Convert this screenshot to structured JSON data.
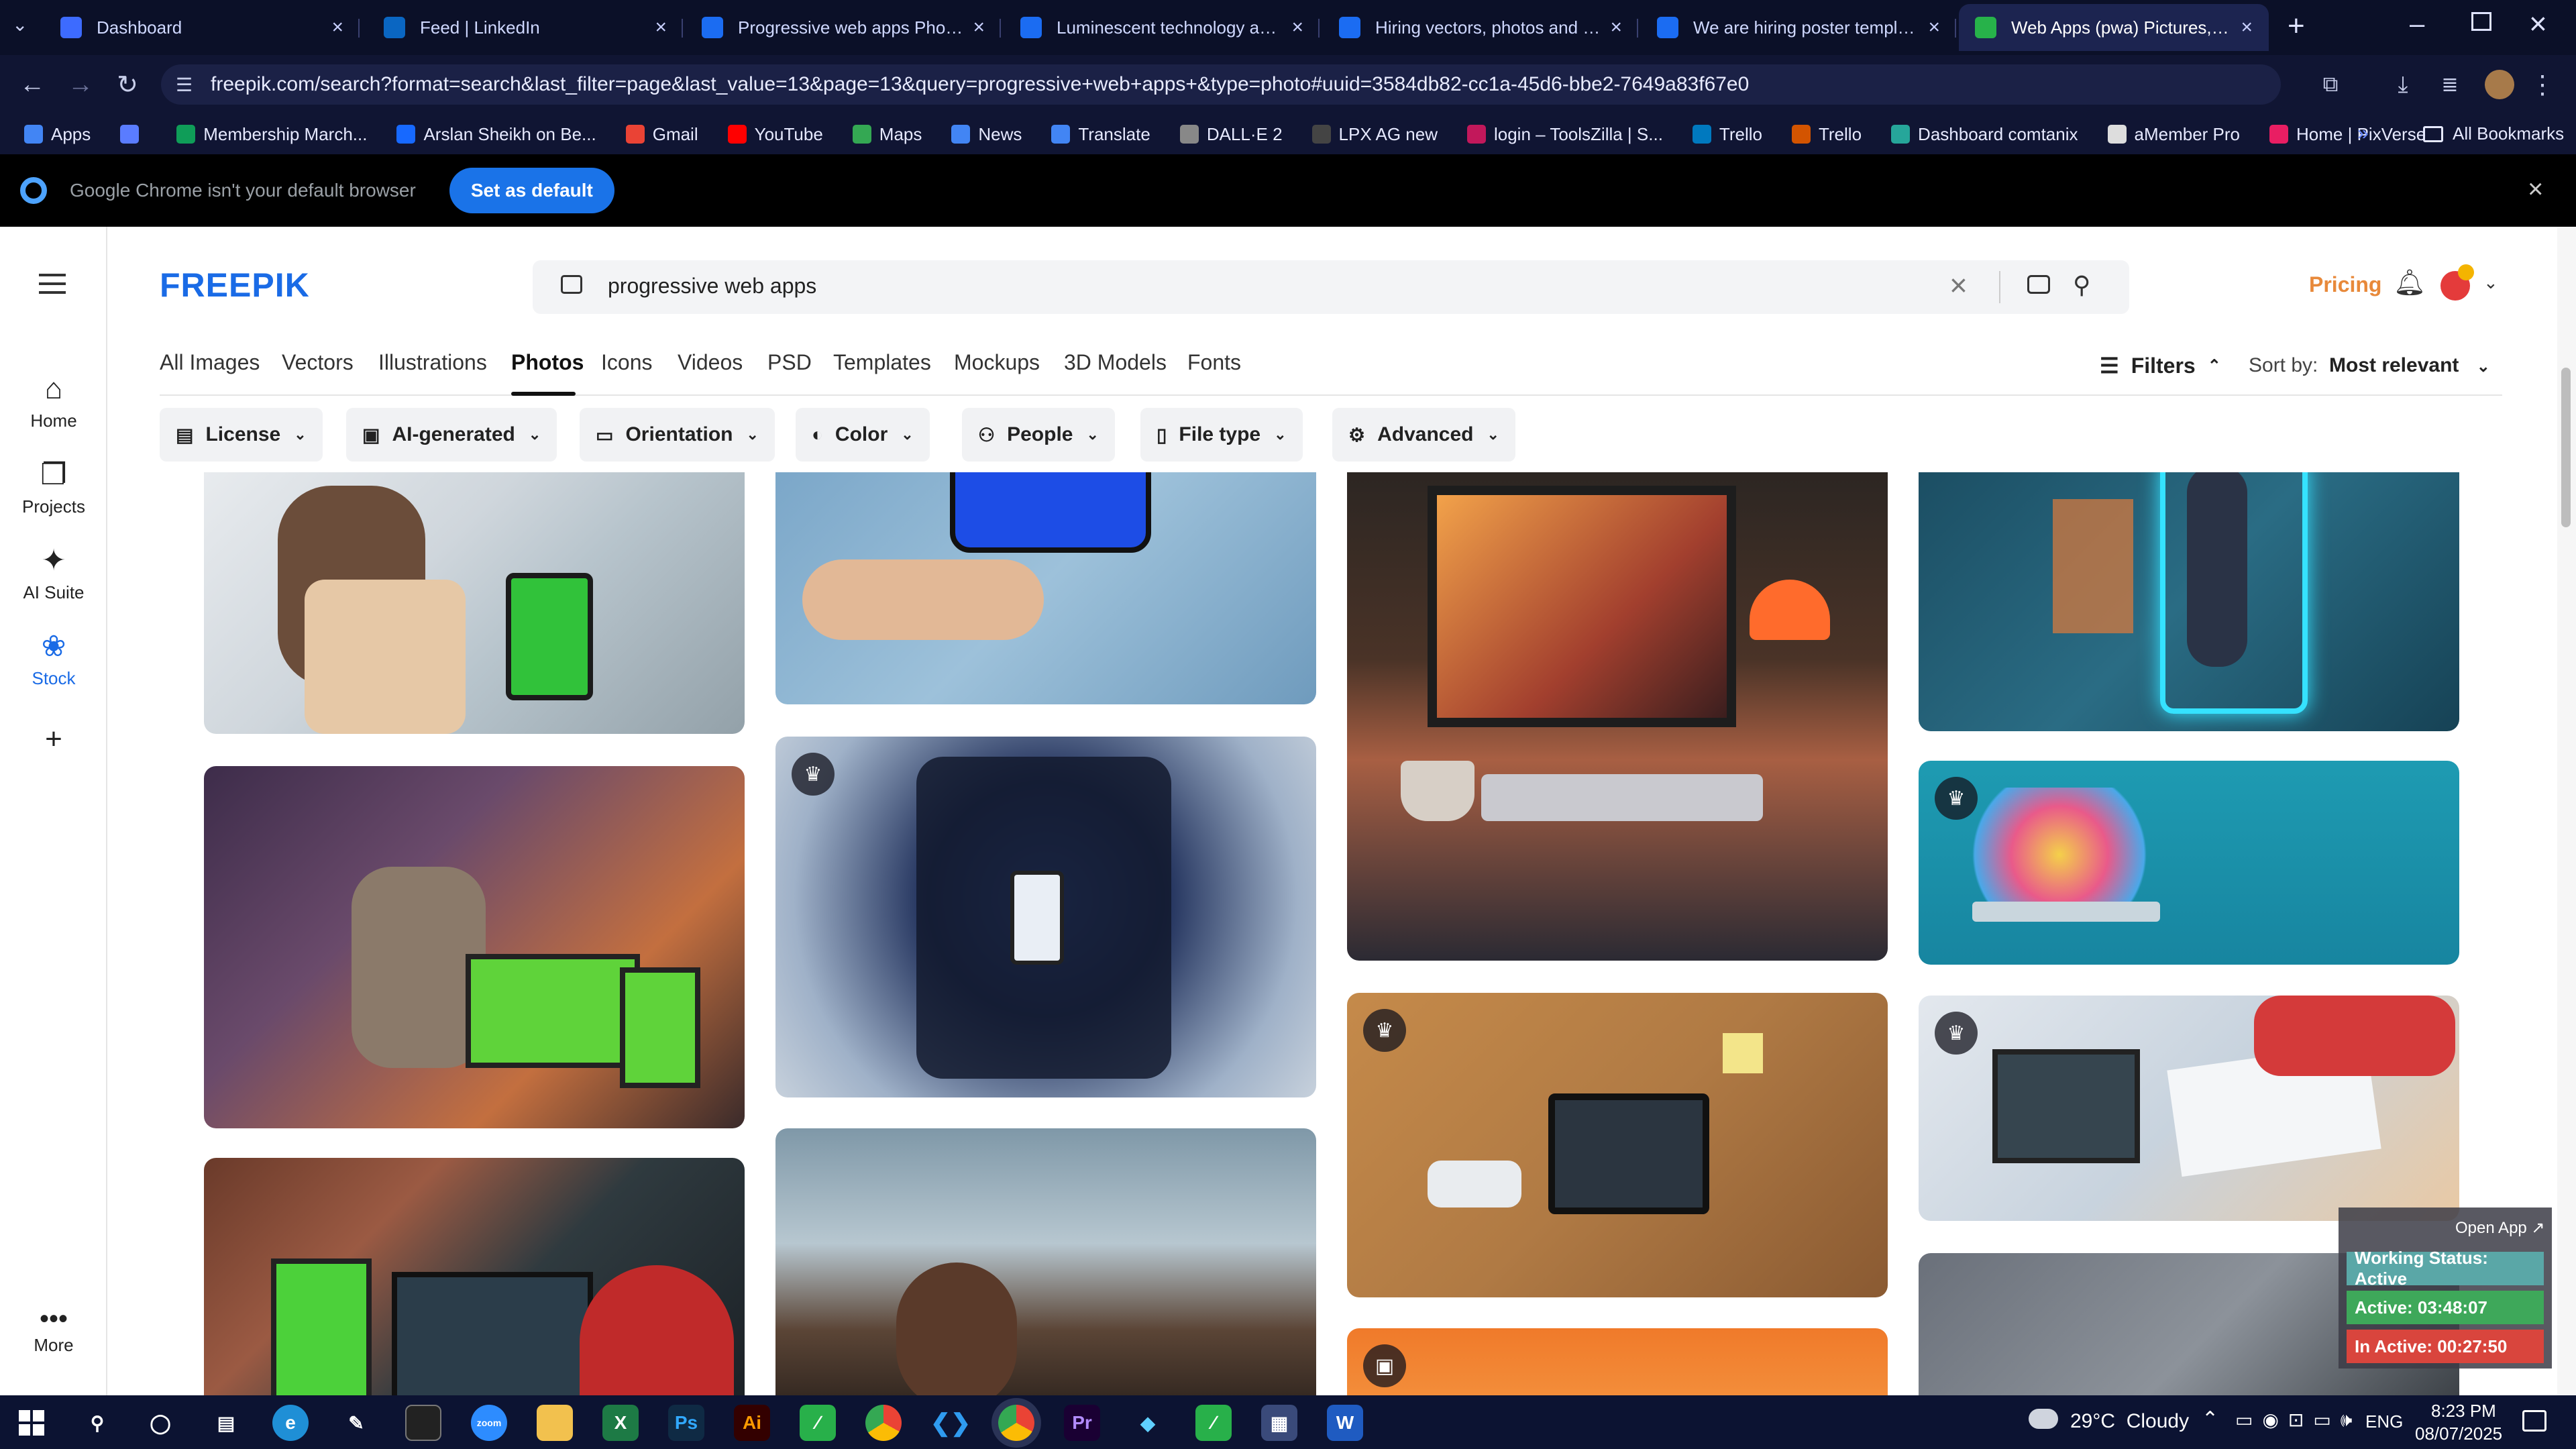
{
  "browser": {
    "tabs": [
      {
        "title": "Dashboard",
        "color": "#3d6bff"
      },
      {
        "title": "Feed | LinkedIn",
        "color": "#0a66c2"
      },
      {
        "title": "Progressive web apps Photos | Fr",
        "color": "#1b6cf2"
      },
      {
        "title": "Luminescent technology and app",
        "color": "#1b6cf2"
      },
      {
        "title": "Hiring vectors, photos and PSD",
        "color": "#1b6cf2"
      },
      {
        "title": "We are hiring poster template",
        "color": "#1b6cf2"
      },
      {
        "title": "Web Apps (pwa) Pictures, Image",
        "color": "#27b24a"
      }
    ],
    "url": "freepik.com/search?format=search&last_filter=page&last_value=13&page=13&query=progressive+web+apps+&type=photo#uuid=3584db82-cc1a-45d6-bbe2-7649a83f67e0",
    "bookmarks": [
      {
        "label": "Apps",
        "color": "#4285f4"
      },
      {
        "label": "",
        "color": "#5a7cff"
      },
      {
        "label": "Membership March...",
        "color": "#0f9d58"
      },
      {
        "label": "Arslan Sheikh on Be...",
        "color": "#1769ff"
      },
      {
        "label": "Gmail",
        "color": "#ea4335"
      },
      {
        "label": "YouTube",
        "color": "#ff0000"
      },
      {
        "label": "Maps",
        "color": "#34a853"
      },
      {
        "label": "News",
        "color": "#4285f4"
      },
      {
        "label": "Translate",
        "color": "#4285f4"
      },
      {
        "label": "DALL·E 2",
        "color": "#888888"
      },
      {
        "label": "LPX AG new",
        "color": "#444444"
      },
      {
        "label": "login – ToolsZilla | S...",
        "color": "#c2185b"
      },
      {
        "label": "Trello",
        "color": "#0079bf"
      },
      {
        "label": "Trello",
        "color": "#d35400"
      },
      {
        "label": "Dashboard comtanix",
        "color": "#26a69a"
      },
      {
        "label": "aMember Pro",
        "color": "#dddddd"
      },
      {
        "label": "Home | PixVerse",
        "color": "#e91e63"
      }
    ],
    "all_bookmarks": "All Bookmarks",
    "infobar": {
      "message": "Google Chrome isn't your default browser",
      "button": "Set as default"
    }
  },
  "app": {
    "logo": "FREEPIK",
    "search": {
      "value": "progressive web apps"
    },
    "pricing": "Pricing",
    "sidebar": [
      {
        "label": "Home",
        "icon": "home-icon"
      },
      {
        "label": "Projects",
        "icon": "projects-icon"
      },
      {
        "label": "AI Suite",
        "icon": "ai-suite-icon"
      },
      {
        "label": "Stock",
        "icon": "stock-icon"
      },
      {
        "label": "",
        "icon": "plus-icon"
      }
    ],
    "more": "More",
    "tabs": [
      "All Images",
      "Vectors",
      "Illustrations",
      "Photos",
      "Icons",
      "Videos",
      "PSD",
      "Templates",
      "Mockups",
      "3D Models",
      "Fonts"
    ],
    "active_tab": "Photos",
    "filters_label": "Filters",
    "sort_label": "Sort by:",
    "sort_value": "Most relevant",
    "filter_buttons": [
      "License",
      "AI-generated",
      "Orientation",
      "Color",
      "People",
      "File type",
      "Advanced"
    ],
    "accent": "#1a6be6",
    "pricing_color": "#e8893a"
  },
  "widget": {
    "open_app": "Open App ↗",
    "working": "Working Status: Active",
    "active": "Active: 03:48:07",
    "inactive": "In Active: 00:27:50"
  },
  "taskbar": {
    "weather": "29°C  Cloudy",
    "lang": "ENG",
    "time": "8:23 PM",
    "date": "08/07/2025"
  }
}
